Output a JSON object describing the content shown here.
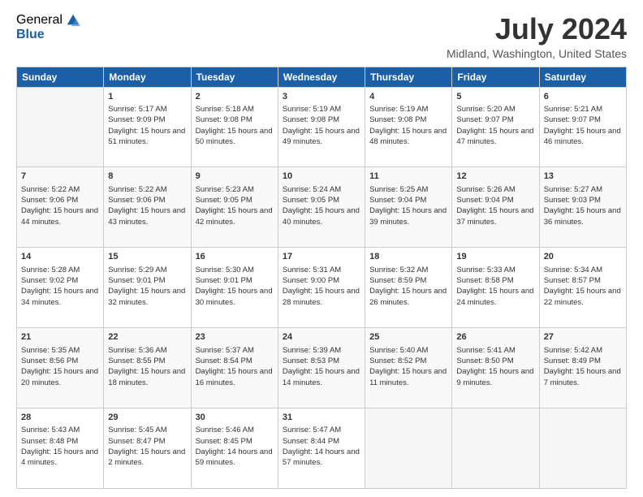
{
  "logo": {
    "general": "General",
    "blue": "Blue"
  },
  "title": "July 2024",
  "location": "Midland, Washington, United States",
  "days_of_week": [
    "Sunday",
    "Monday",
    "Tuesday",
    "Wednesday",
    "Thursday",
    "Friday",
    "Saturday"
  ],
  "weeks": [
    [
      {
        "day": "",
        "empty": true
      },
      {
        "day": "1",
        "sunrise": "Sunrise: 5:17 AM",
        "sunset": "Sunset: 9:09 PM",
        "daylight": "Daylight: 15 hours and 51 minutes."
      },
      {
        "day": "2",
        "sunrise": "Sunrise: 5:18 AM",
        "sunset": "Sunset: 9:08 PM",
        "daylight": "Daylight: 15 hours and 50 minutes."
      },
      {
        "day": "3",
        "sunrise": "Sunrise: 5:19 AM",
        "sunset": "Sunset: 9:08 PM",
        "daylight": "Daylight: 15 hours and 49 minutes."
      },
      {
        "day": "4",
        "sunrise": "Sunrise: 5:19 AM",
        "sunset": "Sunset: 9:08 PM",
        "daylight": "Daylight: 15 hours and 48 minutes."
      },
      {
        "day": "5",
        "sunrise": "Sunrise: 5:20 AM",
        "sunset": "Sunset: 9:07 PM",
        "daylight": "Daylight: 15 hours and 47 minutes."
      },
      {
        "day": "6",
        "sunrise": "Sunrise: 5:21 AM",
        "sunset": "Sunset: 9:07 PM",
        "daylight": "Daylight: 15 hours and 46 minutes."
      }
    ],
    [
      {
        "day": "7",
        "sunrise": "Sunrise: 5:22 AM",
        "sunset": "Sunset: 9:06 PM",
        "daylight": "Daylight: 15 hours and 44 minutes."
      },
      {
        "day": "8",
        "sunrise": "Sunrise: 5:22 AM",
        "sunset": "Sunset: 9:06 PM",
        "daylight": "Daylight: 15 hours and 43 minutes."
      },
      {
        "day": "9",
        "sunrise": "Sunrise: 5:23 AM",
        "sunset": "Sunset: 9:05 PM",
        "daylight": "Daylight: 15 hours and 42 minutes."
      },
      {
        "day": "10",
        "sunrise": "Sunrise: 5:24 AM",
        "sunset": "Sunset: 9:05 PM",
        "daylight": "Daylight: 15 hours and 40 minutes."
      },
      {
        "day": "11",
        "sunrise": "Sunrise: 5:25 AM",
        "sunset": "Sunset: 9:04 PM",
        "daylight": "Daylight: 15 hours and 39 minutes."
      },
      {
        "day": "12",
        "sunrise": "Sunrise: 5:26 AM",
        "sunset": "Sunset: 9:04 PM",
        "daylight": "Daylight: 15 hours and 37 minutes."
      },
      {
        "day": "13",
        "sunrise": "Sunrise: 5:27 AM",
        "sunset": "Sunset: 9:03 PM",
        "daylight": "Daylight: 15 hours and 36 minutes."
      }
    ],
    [
      {
        "day": "14",
        "sunrise": "Sunrise: 5:28 AM",
        "sunset": "Sunset: 9:02 PM",
        "daylight": "Daylight: 15 hours and 34 minutes."
      },
      {
        "day": "15",
        "sunrise": "Sunrise: 5:29 AM",
        "sunset": "Sunset: 9:01 PM",
        "daylight": "Daylight: 15 hours and 32 minutes."
      },
      {
        "day": "16",
        "sunrise": "Sunrise: 5:30 AM",
        "sunset": "Sunset: 9:01 PM",
        "daylight": "Daylight: 15 hours and 30 minutes."
      },
      {
        "day": "17",
        "sunrise": "Sunrise: 5:31 AM",
        "sunset": "Sunset: 9:00 PM",
        "daylight": "Daylight: 15 hours and 28 minutes."
      },
      {
        "day": "18",
        "sunrise": "Sunrise: 5:32 AM",
        "sunset": "Sunset: 8:59 PM",
        "daylight": "Daylight: 15 hours and 26 minutes."
      },
      {
        "day": "19",
        "sunrise": "Sunrise: 5:33 AM",
        "sunset": "Sunset: 8:58 PM",
        "daylight": "Daylight: 15 hours and 24 minutes."
      },
      {
        "day": "20",
        "sunrise": "Sunrise: 5:34 AM",
        "sunset": "Sunset: 8:57 PM",
        "daylight": "Daylight: 15 hours and 22 minutes."
      }
    ],
    [
      {
        "day": "21",
        "sunrise": "Sunrise: 5:35 AM",
        "sunset": "Sunset: 8:56 PM",
        "daylight": "Daylight: 15 hours and 20 minutes."
      },
      {
        "day": "22",
        "sunrise": "Sunrise: 5:36 AM",
        "sunset": "Sunset: 8:55 PM",
        "daylight": "Daylight: 15 hours and 18 minutes."
      },
      {
        "day": "23",
        "sunrise": "Sunrise: 5:37 AM",
        "sunset": "Sunset: 8:54 PM",
        "daylight": "Daylight: 15 hours and 16 minutes."
      },
      {
        "day": "24",
        "sunrise": "Sunrise: 5:39 AM",
        "sunset": "Sunset: 8:53 PM",
        "daylight": "Daylight: 15 hours and 14 minutes."
      },
      {
        "day": "25",
        "sunrise": "Sunrise: 5:40 AM",
        "sunset": "Sunset: 8:52 PM",
        "daylight": "Daylight: 15 hours and 11 minutes."
      },
      {
        "day": "26",
        "sunrise": "Sunrise: 5:41 AM",
        "sunset": "Sunset: 8:50 PM",
        "daylight": "Daylight: 15 hours and 9 minutes."
      },
      {
        "day": "27",
        "sunrise": "Sunrise: 5:42 AM",
        "sunset": "Sunset: 8:49 PM",
        "daylight": "Daylight: 15 hours and 7 minutes."
      }
    ],
    [
      {
        "day": "28",
        "sunrise": "Sunrise: 5:43 AM",
        "sunset": "Sunset: 8:48 PM",
        "daylight": "Daylight: 15 hours and 4 minutes."
      },
      {
        "day": "29",
        "sunrise": "Sunrise: 5:45 AM",
        "sunset": "Sunset: 8:47 PM",
        "daylight": "Daylight: 15 hours and 2 minutes."
      },
      {
        "day": "30",
        "sunrise": "Sunrise: 5:46 AM",
        "sunset": "Sunset: 8:45 PM",
        "daylight": "Daylight: 14 hours and 59 minutes."
      },
      {
        "day": "31",
        "sunrise": "Sunrise: 5:47 AM",
        "sunset": "Sunset: 8:44 PM",
        "daylight": "Daylight: 14 hours and 57 minutes."
      },
      {
        "day": "",
        "empty": true
      },
      {
        "day": "",
        "empty": true
      },
      {
        "day": "",
        "empty": true
      }
    ]
  ]
}
